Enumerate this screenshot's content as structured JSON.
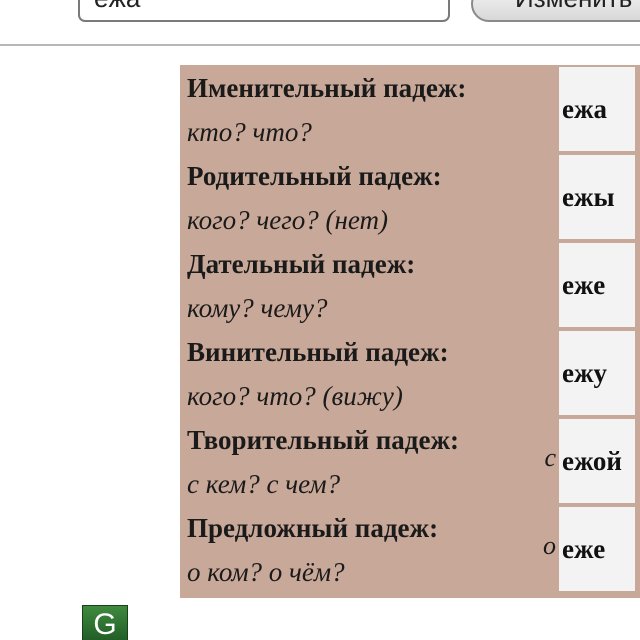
{
  "header": {
    "search_value": "ёжа",
    "search_button_label": "Изменить"
  },
  "declension_table": [
    {
      "case": "Именительный падеж:",
      "question": "кто? что?",
      "preposition": "",
      "answer": "ежа"
    },
    {
      "case": "Родительный падеж:",
      "question": "кого? чего? (нет)",
      "preposition": "",
      "answer": "ежы"
    },
    {
      "case": "Дательный падеж:",
      "question": "кому? чему?",
      "preposition": "",
      "answer": "еже"
    },
    {
      "case": "Винительный падеж:",
      "question": "кого? что? (вижу)",
      "preposition": "",
      "answer": "ежу"
    },
    {
      "case": "Творительный падеж:",
      "question": "с кем? с чем?",
      "preposition": "с",
      "answer": "ежой"
    },
    {
      "case": "Предложный падеж:",
      "question": "о ком? о чём?",
      "preposition": "о",
      "answer": "еже"
    }
  ],
  "footer": {
    "g_icon_letter": "G"
  },
  "colors": {
    "table_background": "#c8a898",
    "answer_background": "#f3f3f3",
    "icon_green": "#2e6e30"
  }
}
